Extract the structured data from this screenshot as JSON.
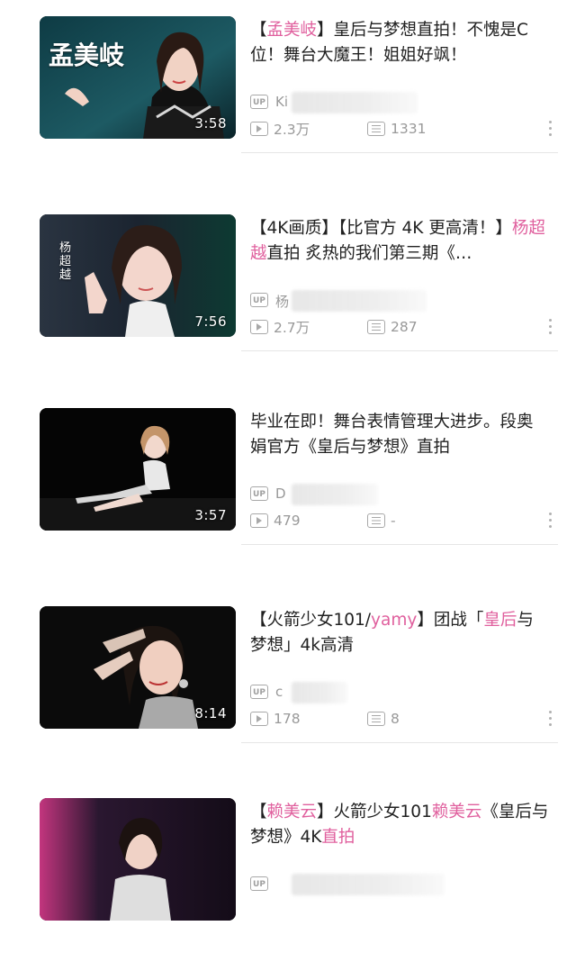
{
  "videos": [
    {
      "title_parts": [
        {
          "text": "【",
          "pink": false
        },
        {
          "text": "孟美岐",
          "pink": true
        },
        {
          "text": "】皇后与梦想直拍！不愧是C位！舞台大魔王！姐姐好飒！",
          "pink": false
        }
      ],
      "thumb_text": "孟美岐",
      "duration": "3:58",
      "up_label": "UP",
      "up_name": "Ki",
      "views": "2.3万",
      "danmaku": "1331"
    },
    {
      "title_parts": [
        {
          "text": "【4K画质】【比官方 4K 更高清！】",
          "pink": false
        },
        {
          "text": "杨超越",
          "pink": true
        },
        {
          "text": "直拍 炙热的我们第三期《…",
          "pink": false
        }
      ],
      "thumb_text": "杨超越",
      "duration": "7:56",
      "up_label": "UP",
      "up_name": "杨",
      "views": "2.7万",
      "danmaku": "287"
    },
    {
      "title_parts": [
        {
          "text": "毕业在即！舞台表情管理大进步。段奥娟官方《皇后与梦想》直拍",
          "pink": false
        }
      ],
      "thumb_text": "",
      "duration": "3:57",
      "up_label": "UP",
      "up_name": "D",
      "views": "479",
      "danmaku": "-"
    },
    {
      "title_parts": [
        {
          "text": "【火箭少女101/",
          "pink": false
        },
        {
          "text": "yamy",
          "pink": true
        },
        {
          "text": "】团战「",
          "pink": false
        },
        {
          "text": "皇后",
          "pink": true
        },
        {
          "text": "与梦想」4k高清",
          "pink": false
        }
      ],
      "thumb_text": "",
      "duration": "8:14",
      "up_label": "UP",
      "up_name": "c",
      "views": "178",
      "danmaku": "8"
    },
    {
      "title_parts": [
        {
          "text": "【",
          "pink": false
        },
        {
          "text": "赖美云",
          "pink": true
        },
        {
          "text": "】火箭少女101",
          "pink": false
        },
        {
          "text": "赖美云",
          "pink": true
        },
        {
          "text": "《皇后与梦想》4K",
          "pink": false
        },
        {
          "text": "直拍",
          "pink": true
        }
      ],
      "thumb_text": "",
      "duration": "",
      "up_label": "UP",
      "up_name": "",
      "views": "",
      "danmaku": ""
    }
  ],
  "colors": {
    "accent_pink": "#e0609e",
    "meta_gray": "#999999",
    "title": "#212121"
  }
}
